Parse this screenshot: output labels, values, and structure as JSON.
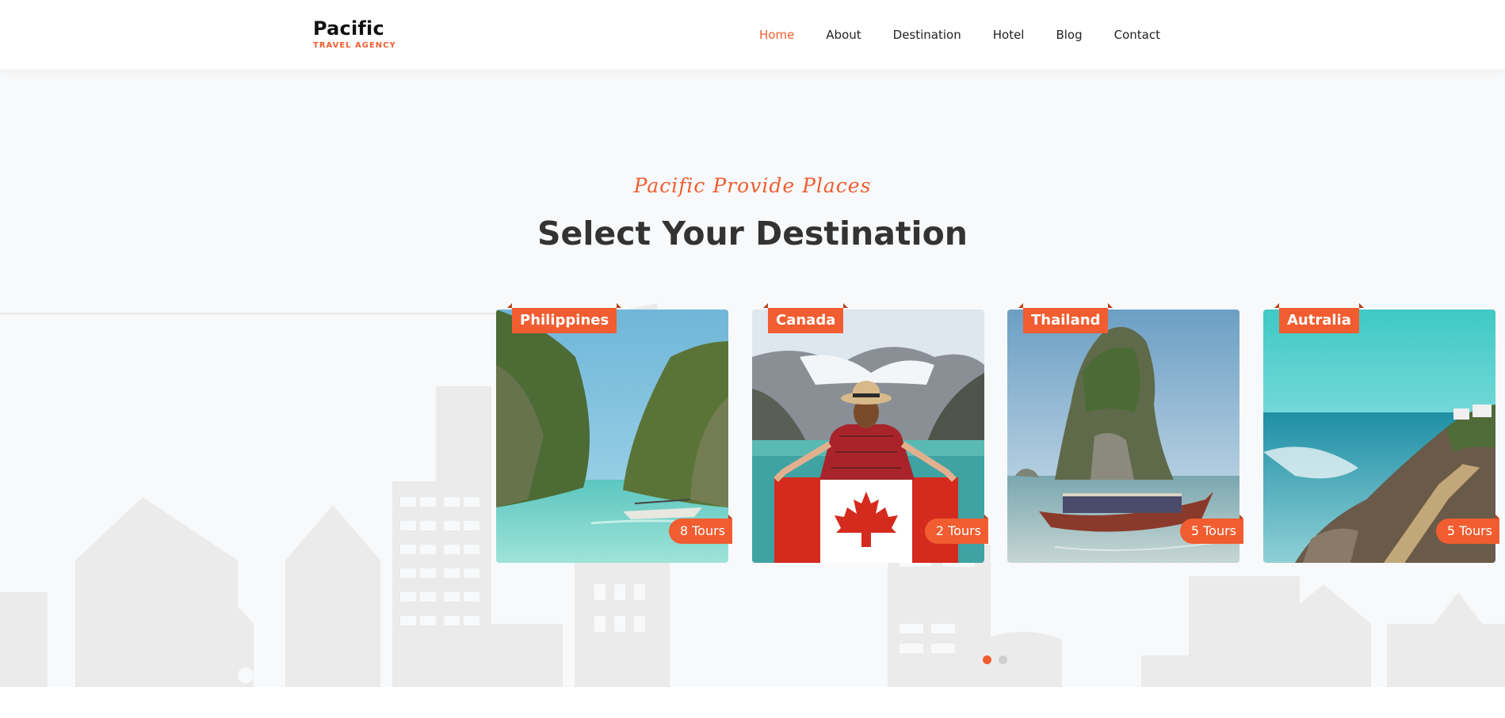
{
  "header": {
    "logo_name": "Pacific",
    "logo_tagline": "TRAVEL AGENCY",
    "nav": [
      {
        "label": "Home",
        "active": true
      },
      {
        "label": "About",
        "active": false
      },
      {
        "label": "Destination",
        "active": false
      },
      {
        "label": "Hotel",
        "active": false
      },
      {
        "label": "Blog",
        "active": false
      },
      {
        "label": "Contact",
        "active": false
      }
    ]
  },
  "section": {
    "subtitle": "Pacific Provide Places",
    "title": "Select Your Destination"
  },
  "destinations": [
    {
      "name": "Philippines",
      "tours": "8 Tours",
      "image": "lagoon-cliffs-photo"
    },
    {
      "name": "Canada",
      "tours": "2 Tours",
      "image": "canada-flag-lake-photo"
    },
    {
      "name": "Thailand",
      "tours": "5 Tours",
      "image": "limestone-rock-boat-photo"
    },
    {
      "name": "Autralia",
      "tours": "5 Tours",
      "image": "coastal-boardwalk-photo"
    }
  ],
  "carousel": {
    "pages": 2,
    "active_page": 1
  },
  "colors": {
    "accent": "#f15d30",
    "background": "#f8f9fa",
    "heading": "#333333"
  }
}
